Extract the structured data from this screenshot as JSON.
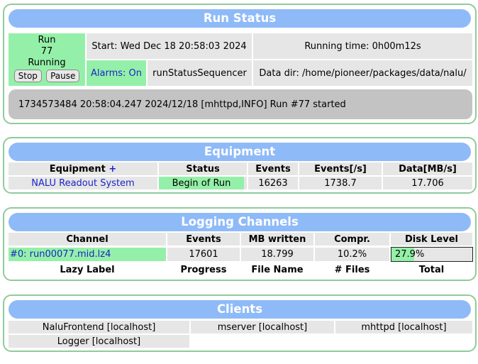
{
  "run_status": {
    "title": "Run Status",
    "run_label": "Run",
    "run_number": "77",
    "state": "Running",
    "stop_label": "Stop",
    "pause_label": "Pause",
    "start_time": "Start: Wed Dec 18 20:58:03 2024",
    "running_time": "Running time: 0h00m12s",
    "alarms": "Alarms: On",
    "sequencer": "runStatusSequencer",
    "data_dir": "Data dir: /home/pioneer/packages/data/nalu/",
    "message": "1734573484 20:58:04.247 2024/12/18 [mhttpd,INFO] Run #77 started"
  },
  "equipment": {
    "title": "Equipment",
    "headers": {
      "equipment": "Equipment",
      "plus": "+",
      "status": "Status",
      "events": "Events",
      "rate": "Events[/s]",
      "data": "Data[MB/s]"
    },
    "rows": [
      {
        "name": "NALU Readout System",
        "status": "Begin of Run",
        "events": "16263",
        "rate": "1738.7",
        "data": "17.706"
      }
    ]
  },
  "logging": {
    "title": "Logging Channels",
    "headers": [
      "Channel",
      "Events",
      "MB written",
      "Compr.",
      "Disk Level"
    ],
    "rows": [
      {
        "channel": "#0: run00077.mid.lz4",
        "events": "17601",
        "mb_written": "18.799",
        "compr": "10.2%",
        "disk_level": "27.9%",
        "disk_fraction": 0.279
      }
    ],
    "lazy_headers": [
      "Lazy Label",
      "Progress",
      "File Name",
      "# Files",
      "Total"
    ]
  },
  "clients": {
    "title": "Clients",
    "items": [
      "NaluFrontend [localhost]",
      "mserver [localhost]",
      "mhttpd [localhost]",
      "Logger [localhost]"
    ]
  },
  "colors": {
    "panel_border": "#8fcb9a",
    "title_bar": "#8fbaf8",
    "cell": "#e6e6e6",
    "green": "#94f0a8",
    "link_blue": "#1a24c8",
    "message_bg": "#c3c3c3"
  }
}
